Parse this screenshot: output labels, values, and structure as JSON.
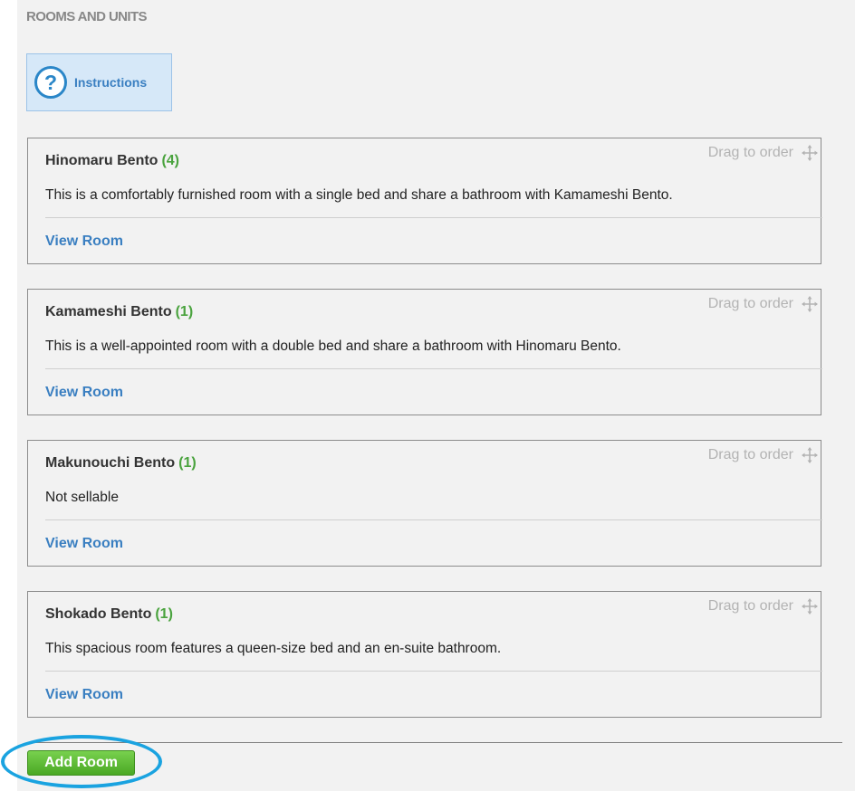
{
  "section": {
    "title": "ROOMS AND UNITS"
  },
  "instructions": {
    "label": "Instructions",
    "icon": "help-icon"
  },
  "rooms": [
    {
      "name": "Hinomaru Bento",
      "count": "(4)",
      "description": "This is a comfortably furnished room with a single bed and share a bathroom with Kamameshi Bento.",
      "drag_label": "Drag to order",
      "view_label": "View Room"
    },
    {
      "name": "Kamameshi Bento",
      "count": "(1)",
      "description": "This is a well-appointed room with a double bed and share a bathroom with Hinomaru Bento.",
      "drag_label": "Drag to order",
      "view_label": "View Room"
    },
    {
      "name": "Makunouchi Bento",
      "count": "(1)",
      "description": "Not sellable",
      "drag_label": "Drag to order",
      "view_label": "View Room"
    },
    {
      "name": "Shokado Bento",
      "count": "(1)",
      "description": "This spacious room features a queen-size bed and an en-suite bathroom.",
      "drag_label": "Drag to order",
      "view_label": "View Room"
    }
  ],
  "actions": {
    "add_room_label": "Add Room"
  },
  "colors": {
    "accent_blue": "#3a7fc1",
    "count_green": "#4aa33e",
    "button_green": "#4aa824",
    "highlight_ring": "#1aa3e0"
  }
}
